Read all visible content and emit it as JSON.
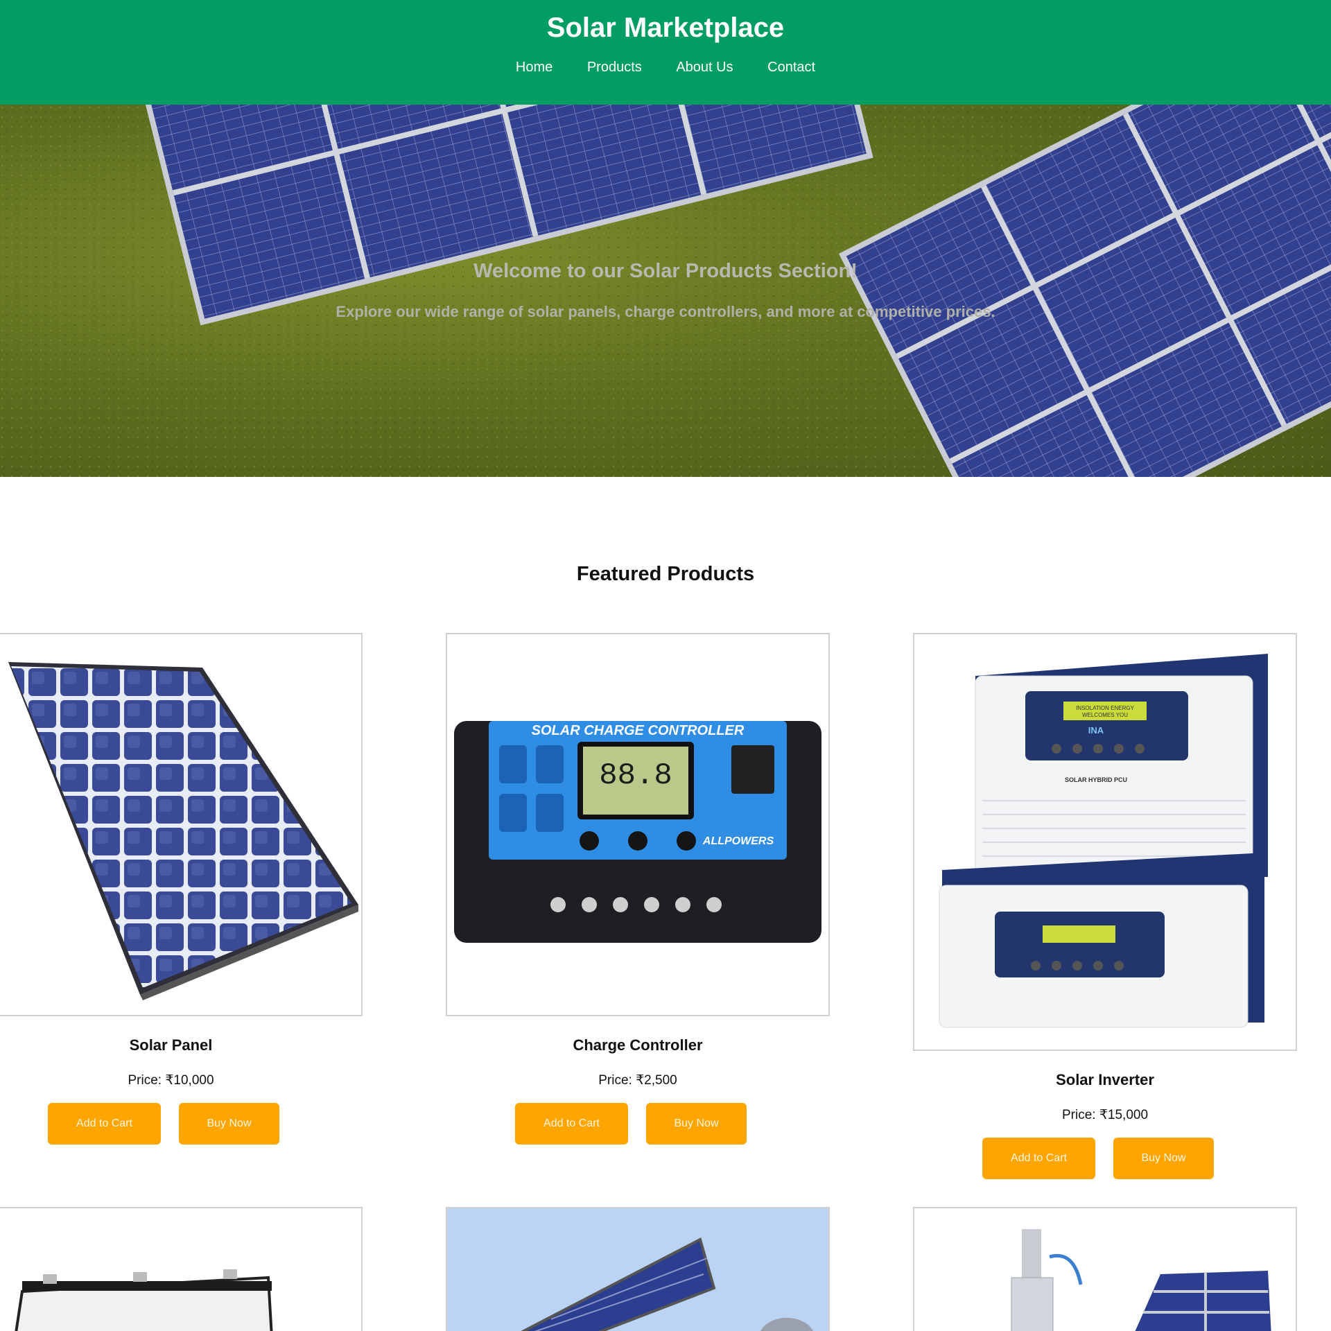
{
  "header": {
    "title": "Solar Marketplace",
    "nav": [
      "Home",
      "Products",
      "About Us",
      "Contact"
    ]
  },
  "hero": {
    "title": "Welcome to our Solar Products Section!",
    "subtitle": "Explore our wide range of solar panels, charge controllers, and more at competitive prices."
  },
  "featured": {
    "title": "Featured Products",
    "products": [
      {
        "name": "Solar Panel",
        "price": "Price: ₹10,000",
        "add_to_cart": "Add to Cart",
        "buy_now": "Buy Now"
      },
      {
        "name": "Charge Controller",
        "price": "Price: ₹2,500",
        "add_to_cart": "Add to Cart",
        "buy_now": "Buy Now"
      },
      {
        "name": "Solar Inverter",
        "price": "Price: ₹15,000",
        "add_to_cart": "Add to Cart",
        "buy_now": "Buy Now"
      }
    ]
  },
  "images": {
    "controller_title": "SOLAR CHARGE CONTROLLER",
    "controller_display": "88.8",
    "controller_brand": "ALLPOWERS",
    "inverter_label": "SOLAR HYBRID PCU",
    "inverter_screen_1": "INSOLATION ENERGY",
    "inverter_screen_2": "WELCOMES YOU",
    "inverter_logo": "INA"
  },
  "colors": {
    "header_bg": "#029d62",
    "button_bg": "#ffa500",
    "hero_grass": "#5f7020",
    "panel_blue": "#2b3a8c"
  }
}
